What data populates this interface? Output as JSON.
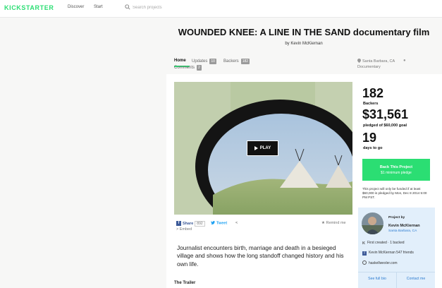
{
  "header": {
    "logo": "KICKSTARTER",
    "nav": {
      "discover": "Discover",
      "start": "Start"
    },
    "search_placeholder": "Search projects"
  },
  "project": {
    "title": "WOUNDED KNEE: A LINE IN THE SAND documentary film",
    "byline": "by Kevin McKiernan"
  },
  "tabs": [
    {
      "label": "Home"
    },
    {
      "label": "Updates",
      "count": "10"
    },
    {
      "label": "Backers",
      "count": "182"
    },
    {
      "label": "Comments",
      "count": "2"
    }
  ],
  "meta": {
    "location": "Santa Barbara, CA",
    "category": "Documentary"
  },
  "video": {
    "play_label": "PLAY"
  },
  "share": {
    "facebook_label": "Share",
    "facebook_count": "892",
    "facebook_glyph": "f",
    "tweet_label": "Tweet",
    "more_glyph": "<",
    "embed_label": "Embed",
    "remind_label": "Remind me"
  },
  "blurb": "Journalist encounters birth, marriage and death in a besieged village and shows how the long standoff changed history and his own life.",
  "section_heading": "The Trailer",
  "stats": {
    "backers_value": "182",
    "backers_label": "Backers",
    "pledged_value": "$31,561",
    "pledged_label": "pledged of $60,000 goal",
    "days_value": "19",
    "days_label": "days to go"
  },
  "cta": {
    "back_label": "Back This Project",
    "back_sub": "$1 minimum pledge",
    "funding_note": "This project will only be funded if at least $60,000 is pledged by Mon, Dec 8 2014 5:00 PM PST."
  },
  "creator": {
    "project_by": "Project by",
    "name": "Kevin McKiernan",
    "location": "Santa Barbara, CA",
    "created_backed": "First created · 1 backed",
    "facebook": "Kevin McKiernan 547 friends",
    "website": "haskellwexler.com",
    "see_bio": "See full bio",
    "contact": "Contact me"
  },
  "colors": {
    "brand_green": "#2bde73",
    "link_blue": "#2b7bd0",
    "facebook_blue": "#3b5998",
    "twitter_blue": "#1da1f2",
    "creator_card_bg": "#e2effb"
  },
  "icons": [
    "search-icon",
    "location-pin-icon",
    "tag-icon",
    "play-icon",
    "facebook-icon",
    "twitter-icon",
    "chevron-left-icon",
    "star-icon",
    "kickstarter-k-icon",
    "globe-icon"
  ]
}
